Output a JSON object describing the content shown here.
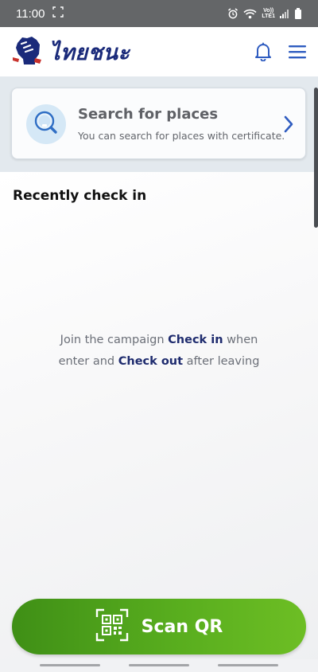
{
  "status_bar": {
    "time": "11:00",
    "network_top": "Vo))",
    "network_bottom": "LTE1"
  },
  "app": {
    "brand_name": "ไทยชนะ"
  },
  "search_card": {
    "title": "Search for places",
    "subtitle": "You can search for places with certificate."
  },
  "recent": {
    "title": "Recently check in",
    "empty_line1_before": "Join the campaign ",
    "empty_line1_bold": "Check in",
    "empty_line1_after": " when",
    "empty_line2_before": "enter and ",
    "empty_line2_bold": "Check out",
    "empty_line2_after": " after leaving"
  },
  "scan_button": {
    "label": "Scan QR"
  },
  "icons": {
    "logo": "raised-fist-logo-icon",
    "notification": "bell-icon",
    "menu": "hamburger-menu-icon",
    "search": "magnifier-search-icon",
    "chevron": "chevron-right-icon",
    "qr": "qr-code-scan-icon"
  },
  "colors": {
    "brand_navy": "#1a2a7a",
    "accent_blue": "#2f5cc0",
    "scan_green_start": "#3f8f16",
    "scan_green_end": "#6dbe24",
    "status_bar": "#646668"
  }
}
